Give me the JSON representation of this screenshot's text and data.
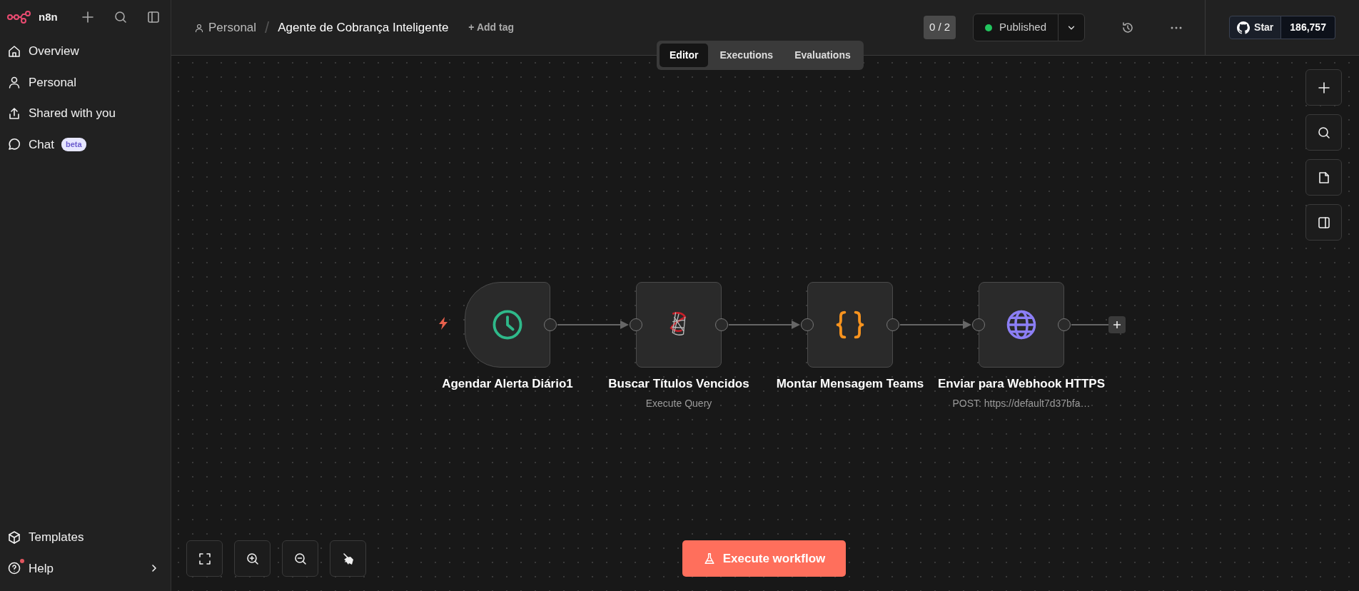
{
  "app": {
    "name": "n8n"
  },
  "sidebar": {
    "items": [
      {
        "label": "Overview"
      },
      {
        "label": "Personal"
      },
      {
        "label": "Shared with you"
      },
      {
        "label": "Chat",
        "badge": "beta"
      }
    ],
    "footer": [
      {
        "label": "Templates",
        "notification": false,
        "expandable": false
      },
      {
        "label": "Help",
        "notification": true,
        "expandable": true
      }
    ]
  },
  "header": {
    "project": "Personal",
    "separator": "/",
    "title": "Agente de Cobrança Inteligente",
    "add_tag": "+ Add tag",
    "counter": "0 / 2",
    "publish": {
      "label": "Published",
      "active": true
    },
    "github": {
      "label": "Star",
      "count": "186,757"
    }
  },
  "tabs": [
    {
      "label": "Editor",
      "selected": true
    },
    {
      "label": "Executions",
      "selected": false
    },
    {
      "label": "Evaluations",
      "selected": false
    }
  ],
  "workflow": {
    "nodes": [
      {
        "title": "Agendar Alerta Diário1",
        "kind": "schedule",
        "trigger": true
      },
      {
        "title": "Buscar Títulos Vencidos",
        "subtitle": "Execute Query",
        "kind": "sql",
        "trigger": false
      },
      {
        "title": "Montar Mensagem Teams",
        "kind": "code",
        "trigger": false
      },
      {
        "title": "Enviar para Webhook HTTPS",
        "subtitle": "POST: https://default7d37bfa…",
        "kind": "http",
        "trigger": false
      }
    ]
  },
  "execute_button": {
    "label": "Execute workflow"
  }
}
